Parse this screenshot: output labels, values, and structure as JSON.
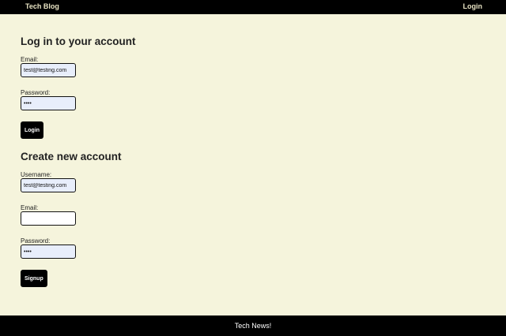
{
  "header": {
    "brand": "Tech Blog",
    "login_link": "Login"
  },
  "login_form": {
    "title": "Log in to your account",
    "email_label": "Email:",
    "email_value": "test@testing.com",
    "password_label": "Password:",
    "password_value": "test",
    "submit_label": "Login"
  },
  "signup_form": {
    "title": "Create new account",
    "username_label": "Username:",
    "username_value": "test@testing.com",
    "email_label": "Email:",
    "email_value": "",
    "password_label": "Password:",
    "password_value": "test",
    "submit_label": "Signup"
  },
  "footer": {
    "text": "Tech News!"
  }
}
